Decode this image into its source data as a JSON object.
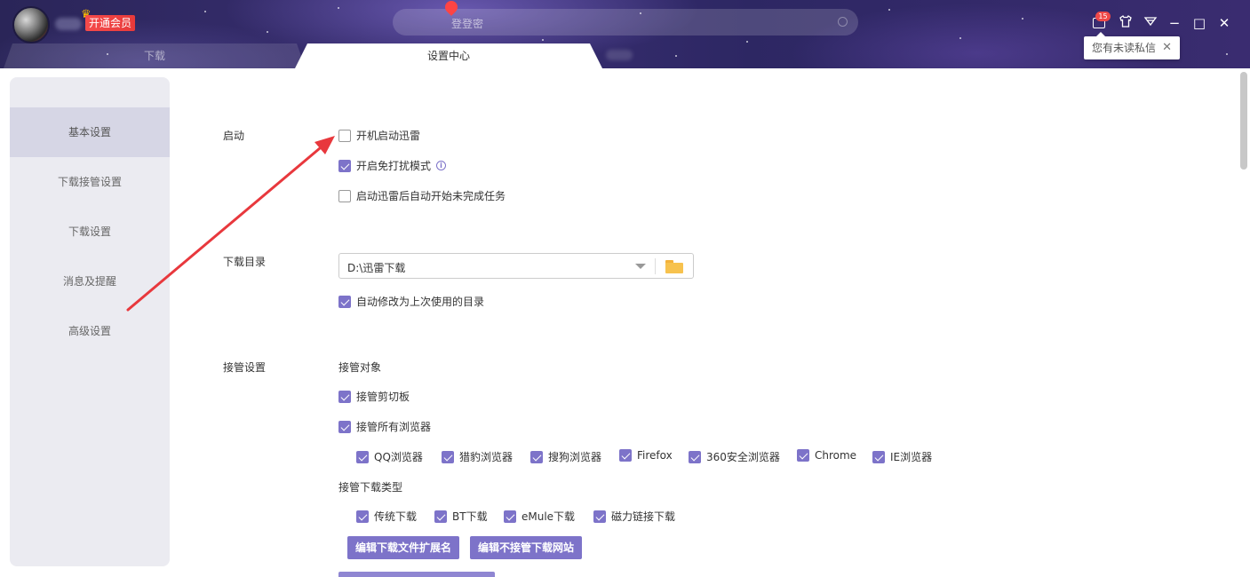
{
  "header": {
    "vip_label": "开通会员",
    "search_placeholder": "登登密",
    "message_badge": "15",
    "tooltip_text": "您有未读私信",
    "tooltip_close": "✕"
  },
  "tabs": [
    {
      "label": "下载"
    },
    {
      "label": "设置中心"
    }
  ],
  "window_controls": {
    "skin": "shirt-icon",
    "menu": "menu-icon",
    "minimize": "−",
    "maximize": "□",
    "close": "✕"
  },
  "sidebar": {
    "items": [
      {
        "label": "基本设置",
        "active": true
      },
      {
        "label": "下载接管设置",
        "active": false
      },
      {
        "label": "下载设置",
        "active": false
      },
      {
        "label": "消息及提醒",
        "active": false
      },
      {
        "label": "高级设置",
        "active": false
      }
    ]
  },
  "startup": {
    "label": "启动",
    "options": [
      {
        "label": "开机启动迅雷",
        "checked": false
      },
      {
        "label": "开启免打扰模式",
        "checked": true
      },
      {
        "label": "启动迅雷后自动开始未完成任务",
        "checked": false
      }
    ]
  },
  "download_dir": {
    "label": "下载目录",
    "value": "D:\\迅雷下载",
    "auto_modify": {
      "label": "自动修改为上次使用的目录",
      "checked": true
    }
  },
  "takeover": {
    "label": "接管设置",
    "targets_label": "接管对象",
    "clipboard": {
      "label": "接管剪切板",
      "checked": true
    },
    "all_browsers": {
      "label": "接管所有浏览器",
      "checked": true
    },
    "browsers": [
      {
        "label": "QQ浏览器",
        "checked": true
      },
      {
        "label": "猎豹浏览器",
        "checked": true
      },
      {
        "label": "搜狗浏览器",
        "checked": true
      },
      {
        "label": "Firefox",
        "checked": true
      },
      {
        "label": "360安全浏览器",
        "checked": true
      },
      {
        "label": "Chrome",
        "checked": true
      },
      {
        "label": "IE浏览器",
        "checked": true
      }
    ],
    "types_label": "接管下载类型",
    "types": [
      {
        "label": "传统下载",
        "checked": true
      },
      {
        "label": "BT下载",
        "checked": true
      },
      {
        "label": "eMule下载",
        "checked": true
      },
      {
        "label": "磁力链接下载",
        "checked": true
      }
    ],
    "buttons": {
      "edit_extensions": "编辑下载文件扩展名",
      "edit_excluded_sites": "编辑不接管下载网站"
    }
  },
  "colors": {
    "accent": "#7d73c9",
    "annotation_arrow": "#e8383d",
    "sidebar_bg": "#ebebf1",
    "sidebar_active": "#d6d6e5"
  }
}
